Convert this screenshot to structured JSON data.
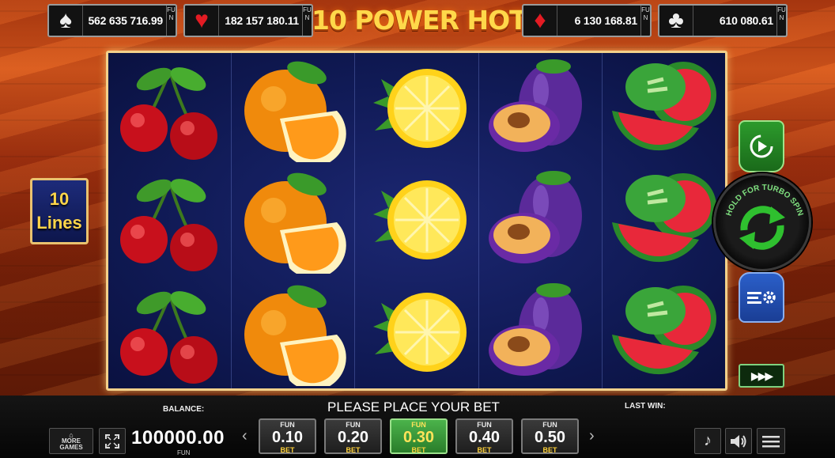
{
  "title": "10 POWER HOT",
  "jackpots": [
    {
      "suit": "spade",
      "symbol": "♠",
      "value": "562 635 716.99",
      "tag": "FUN"
    },
    {
      "suit": "heart",
      "symbol": "♥",
      "value": "182 157 180.11",
      "tag": "FUN"
    },
    {
      "suit": "diamond",
      "symbol": "♦",
      "value": "6 130 168.81",
      "tag": "FUN"
    },
    {
      "suit": "club",
      "symbol": "♣",
      "value": "610 080.61",
      "tag": "FUN"
    }
  ],
  "lines": {
    "count": "10",
    "label": "Lines"
  },
  "reels": [
    [
      "cherry",
      "cherry",
      "cherry"
    ],
    [
      "orange",
      "orange",
      "orange"
    ],
    [
      "lemon",
      "lemon",
      "lemon"
    ],
    [
      "plum",
      "plum",
      "plum"
    ],
    [
      "watermelon",
      "watermelon",
      "watermelon"
    ]
  ],
  "spin": {
    "label": "HOLD FOR TURBO SPIN"
  },
  "bottom": {
    "more_games": "MORE GAMES",
    "balance_label": "BALANCE:",
    "balance_value": "100000.00",
    "balance_currency": "FUN",
    "message": "PLEASE PLACE YOUR BET",
    "last_win_label": "LAST WIN:",
    "bets": [
      {
        "fun": "FUN",
        "amount": "0.10",
        "bet": "BET",
        "active": false
      },
      {
        "fun": "FUN",
        "amount": "0.20",
        "bet": "BET",
        "active": false
      },
      {
        "fun": "FUN",
        "amount": "0.30",
        "bet": "BET",
        "active": true
      },
      {
        "fun": "FUN",
        "amount": "0.40",
        "bet": "BET",
        "active": false
      },
      {
        "fun": "FUN",
        "amount": "0.50",
        "bet": "BET",
        "active": false
      }
    ]
  },
  "colors": {
    "accent_green": "#2c9a2c",
    "reel_bg": "#101a55",
    "gold": "#ffd84a"
  },
  "icons": [
    "spade-icon",
    "heart-icon",
    "diamond-icon",
    "club-icon",
    "autoplay-icon",
    "turbo-spin-icon",
    "settings-icon",
    "fast-forward-icon",
    "more-games-icon",
    "fullscreen-icon",
    "music-icon",
    "sound-icon",
    "menu-icon"
  ]
}
